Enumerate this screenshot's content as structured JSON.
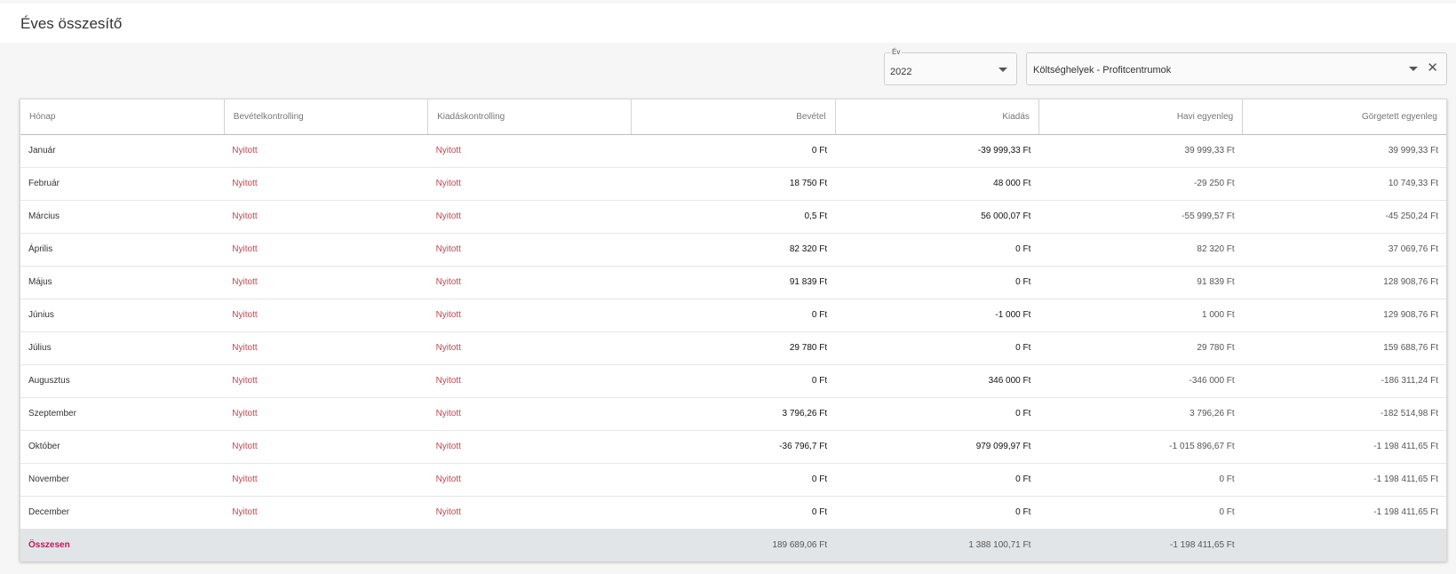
{
  "page": {
    "title": "Éves összesítő"
  },
  "filters": {
    "year_label": "Év",
    "year_value": "2022",
    "cost_center_value": "Költséghelyek - Profitcentrumok"
  },
  "table": {
    "headers": [
      "Hónap",
      "Bevételkontrolling",
      "Kiadáskontrolling",
      "Bevétel",
      "Kiadás",
      "Havi egyenleg",
      "Görgetett egyenleg"
    ],
    "rows": [
      [
        "Január",
        "Nyitott",
        "Nyitott",
        "0 Ft",
        "-39 999,33 Ft",
        "39 999,33 Ft",
        "39 999,33 Ft"
      ],
      [
        "Február",
        "Nyitott",
        "Nyitott",
        "18 750 Ft",
        "48 000 Ft",
        "-29 250 Ft",
        "10 749,33 Ft"
      ],
      [
        "Március",
        "Nyitott",
        "Nyitott",
        "0,5 Ft",
        "56 000,07 Ft",
        "-55 999,57 Ft",
        "-45 250,24 Ft"
      ],
      [
        "Április",
        "Nyitott",
        "Nyitott",
        "82 320 Ft",
        "0 Ft",
        "82 320 Ft",
        "37 069,76 Ft"
      ],
      [
        "Május",
        "Nyitott",
        "Nyitott",
        "91 839 Ft",
        "0 Ft",
        "91 839 Ft",
        "128 908,76 Ft"
      ],
      [
        "Június",
        "Nyitott",
        "Nyitott",
        "0 Ft",
        "-1 000 Ft",
        "1 000 Ft",
        "129 908,76 Ft"
      ],
      [
        "Július",
        "Nyitott",
        "Nyitott",
        "29 780 Ft",
        "0 Ft",
        "29 780 Ft",
        "159 688,76 Ft"
      ],
      [
        "Augusztus",
        "Nyitott",
        "Nyitott",
        "0 Ft",
        "346 000 Ft",
        "-346 000 Ft",
        "-186 311,24 Ft"
      ],
      [
        "Szeptember",
        "Nyitott",
        "Nyitott",
        "3 796,26 Ft",
        "0 Ft",
        "3 796,26 Ft",
        "-182 514,98 Ft"
      ],
      [
        "Október",
        "Nyitott",
        "Nyitott",
        "-36 796,7 Ft",
        "979 099,97 Ft",
        "-1 015 896,67 Ft",
        "-1 198 411,65 Ft"
      ],
      [
        "November",
        "Nyitott",
        "Nyitott",
        "0 Ft",
        "0 Ft",
        "0 Ft",
        "-1 198 411,65 Ft"
      ],
      [
        "December",
        "Nyitott",
        "Nyitott",
        "0 Ft",
        "0 Ft",
        "0 Ft",
        "-1 198 411,65 Ft"
      ]
    ],
    "total": {
      "label": "Összesen",
      "income": "189 689,06 Ft",
      "expense": "1 388 100,71 Ft",
      "monthly_balance": "-1 198 411,65 Ft",
      "rolling_balance": ""
    }
  }
}
